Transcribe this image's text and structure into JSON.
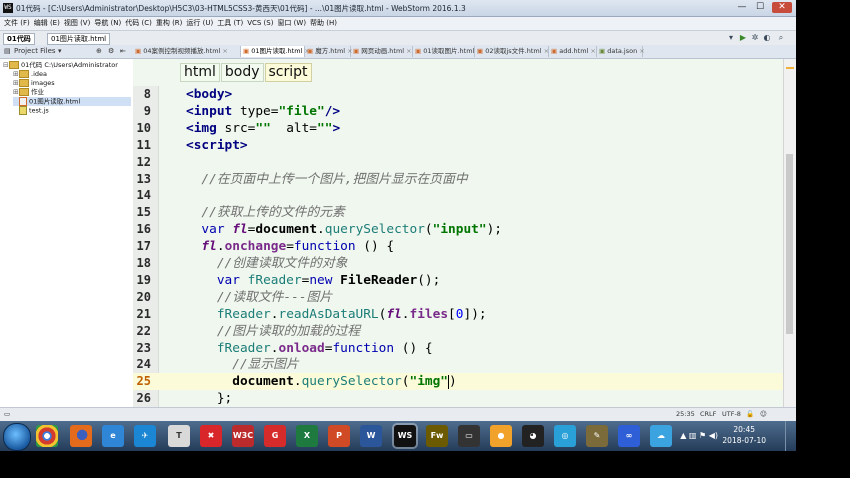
{
  "window": {
    "title": "01代码 - [C:\\Users\\Administrator\\Desktop\\H5C3\\03-HTML5CSS3-黄西天\\01代码] - ...\\01图片读取.html - WebStorm 2016.1.3",
    "app_icon": "WS"
  },
  "menu": [
    "文件 (F)",
    "编辑 (E)",
    "视图 (V)",
    "导航 (N)",
    "代码 (C)",
    "重构 (R)",
    "运行 (U)",
    "工具 (T)",
    "VCS (S)",
    "窗口 (W)",
    "帮助 (H)"
  ],
  "nav": {
    "crumbs": [
      "01代码",
      "01图片读取.html"
    ]
  },
  "project": {
    "header": "Project Files",
    "header_icon": "files-icon",
    "tree": [
      {
        "label": "01代码  C:\\Users\\Administrator",
        "type": "folder",
        "depth": 0,
        "open": true
      },
      {
        "label": ".idea",
        "type": "folder",
        "depth": 1
      },
      {
        "label": "images",
        "type": "folder",
        "depth": 1
      },
      {
        "label": "作业",
        "type": "folder",
        "depth": 1
      },
      {
        "label": "01图片读取.html",
        "type": "html",
        "depth": 1,
        "selected": true
      },
      {
        "label": "test.js",
        "type": "js",
        "depth": 1
      }
    ]
  },
  "tabs": [
    {
      "label": "04案例控制视频播放.html",
      "active": false
    },
    {
      "label": "01图片读取.html",
      "active": true
    },
    {
      "label": "魔方.html",
      "active": false
    },
    {
      "label": "网页动画.html",
      "active": false
    },
    {
      "label": "01读取图片.html",
      "active": false
    },
    {
      "label": "02读取js文件.html",
      "active": false
    },
    {
      "label": "add.html",
      "active": false
    },
    {
      "label": "data.json",
      "active": false
    }
  ],
  "editor": {
    "tag_path": [
      "html",
      "body",
      "script"
    ],
    "current_line": 25,
    "lines": [
      {
        "n": "8",
        "segs": [
          [
            "c-tag",
            "<body>"
          ]
        ]
      },
      {
        "n": "9",
        "segs": [
          [
            "c-tag",
            "<input "
          ],
          [
            "",
            "type="
          ],
          [
            "c-str",
            "\"file\""
          ],
          [
            "c-tag",
            "/>"
          ]
        ]
      },
      {
        "n": "10",
        "segs": [
          [
            "c-tag",
            "<img "
          ],
          [
            "",
            "src="
          ],
          [
            "c-str",
            "\"\""
          ],
          [
            "",
            ""
          ],
          [
            "",
            "  alt="
          ],
          [
            "c-str",
            "\"\""
          ],
          [
            "c-tag",
            ">"
          ]
        ]
      },
      {
        "n": "11",
        "segs": [
          [
            "c-tag",
            "<script>"
          ]
        ]
      },
      {
        "n": "12",
        "segs": []
      },
      {
        "n": "13",
        "segs": [
          [
            "",
            "  "
          ],
          [
            "c-cm",
            "//在页面中上传一个图片,把图片显示在页面中"
          ]
        ]
      },
      {
        "n": "14",
        "segs": []
      },
      {
        "n": "15",
        "segs": [
          [
            "",
            "  "
          ],
          [
            "c-cm",
            "//获取上传的文件的元素"
          ]
        ]
      },
      {
        "n": "16",
        "segs": [
          [
            "",
            "  "
          ],
          [
            "c-kw",
            "var "
          ],
          [
            "c-var",
            "fl"
          ],
          [
            "",
            "="
          ],
          [
            "c-cls",
            "document"
          ],
          [
            "",
            "."
          ],
          [
            "c-fn",
            "querySelector"
          ],
          [
            "",
            "("
          ],
          [
            "c-str",
            "\"input\""
          ],
          [
            "",
            ");"
          ]
        ]
      },
      {
        "n": "17",
        "segs": [
          [
            "",
            "  "
          ],
          [
            "c-var",
            "fl"
          ],
          [
            "",
            "."
          ],
          [
            "c-prop",
            "onchange"
          ],
          [
            "",
            "="
          ],
          [
            "c-kw",
            "function "
          ],
          [
            "",
            "() {"
          ]
        ]
      },
      {
        "n": "18",
        "segs": [
          [
            "",
            "    "
          ],
          [
            "c-cm",
            "//创建读取文件的对象"
          ]
        ]
      },
      {
        "n": "19",
        "segs": [
          [
            "",
            "    "
          ],
          [
            "c-kw",
            "var "
          ],
          [
            "c-fn",
            "fReader"
          ],
          [
            "",
            "="
          ],
          [
            "c-kw",
            "new "
          ],
          [
            "c-cls",
            "FileReader"
          ],
          [
            "",
            "();"
          ]
        ]
      },
      {
        "n": "20",
        "segs": [
          [
            "",
            "    "
          ],
          [
            "c-cm",
            "//读取文件---图片"
          ]
        ]
      },
      {
        "n": "21",
        "segs": [
          [
            "",
            "    "
          ],
          [
            "c-fn",
            "fReader"
          ],
          [
            "",
            "."
          ],
          [
            "c-fn",
            "readAsDataURL"
          ],
          [
            "",
            "("
          ],
          [
            "c-var",
            "fl"
          ],
          [
            "",
            "."
          ],
          [
            "c-prop",
            "files"
          ],
          [
            "",
            "["
          ],
          [
            "c-num",
            "0"
          ],
          [
            "",
            "]);"
          ]
        ]
      },
      {
        "n": "22",
        "segs": [
          [
            "",
            "    "
          ],
          [
            "c-cm",
            "//图片读取的加载的过程"
          ]
        ]
      },
      {
        "n": "23",
        "segs": [
          [
            "",
            "    "
          ],
          [
            "c-fn",
            "fReader"
          ],
          [
            "",
            "."
          ],
          [
            "c-prop",
            "onload"
          ],
          [
            "",
            "="
          ],
          [
            "c-kw",
            "function "
          ],
          [
            "",
            "() {"
          ]
        ]
      },
      {
        "n": "24",
        "segs": [
          [
            "",
            "      "
          ],
          [
            "c-cm",
            "//显示图片"
          ]
        ]
      },
      {
        "n": "25",
        "segs": [
          [
            "",
            "      "
          ],
          [
            "c-cls",
            "document"
          ],
          [
            "",
            "."
          ],
          [
            "c-fn",
            "querySelector"
          ],
          [
            "",
            "("
          ],
          [
            "c-str",
            "\"img\""
          ],
          [
            "caret",
            ""
          ],
          [
            "",
            ")"
          ]
        ]
      },
      {
        "n": "26",
        "segs": [
          [
            "",
            "    };"
          ]
        ]
      }
    ]
  },
  "status": {
    "position": "25:35",
    "line_sep": "CRLF",
    "encoding": "UTF-8"
  },
  "taskbar": {
    "time": "20:45",
    "date": "2018-07-10",
    "apps": [
      {
        "name": "chrome-icon",
        "label": "",
        "color": "#d33b2c"
      },
      {
        "name": "firefox-icon",
        "label": "",
        "color": "#e46b1c"
      },
      {
        "name": "ie-icon",
        "label": "e",
        "color": "#2f86d6"
      },
      {
        "name": "feiyu-icon",
        "label": "✈",
        "color": "#1b86d3"
      },
      {
        "name": "typora-icon",
        "label": "T",
        "color": "#d9d9d9"
      },
      {
        "name": "xmind-icon",
        "label": "✖",
        "color": "#d8262a"
      },
      {
        "name": "w3c-icon",
        "label": "W3C",
        "color": "#bb2b2b"
      },
      {
        "name": "g-icon",
        "label": "G",
        "color": "#d52b2b"
      },
      {
        "name": "excel-icon",
        "label": "X",
        "color": "#1e7a3f"
      },
      {
        "name": "powerpoint-icon",
        "label": "P",
        "color": "#d04a25"
      },
      {
        "name": "word-icon",
        "label": "W",
        "color": "#2b579a"
      },
      {
        "name": "webstorm-icon",
        "label": "WS",
        "color": "#111111",
        "active": true
      },
      {
        "name": "fireworks-icon",
        "label": "Fw",
        "color": "#6b5a00"
      },
      {
        "name": "media-icon",
        "label": "▭",
        "color": "#333333"
      },
      {
        "name": "chat-icon",
        "label": "●",
        "color": "#f1a22b"
      },
      {
        "name": "qq-icon",
        "label": "◕",
        "color": "#222222"
      },
      {
        "name": "browser360-icon",
        "label": "◎",
        "color": "#2aa0d8"
      },
      {
        "name": "brush-icon",
        "label": "✎",
        "color": "#7b6a3a"
      },
      {
        "name": "baidu-icon",
        "label": "∞",
        "color": "#2e5fd6"
      },
      {
        "name": "cloud-icon",
        "label": "☁",
        "color": "#3aa3e0"
      }
    ]
  }
}
